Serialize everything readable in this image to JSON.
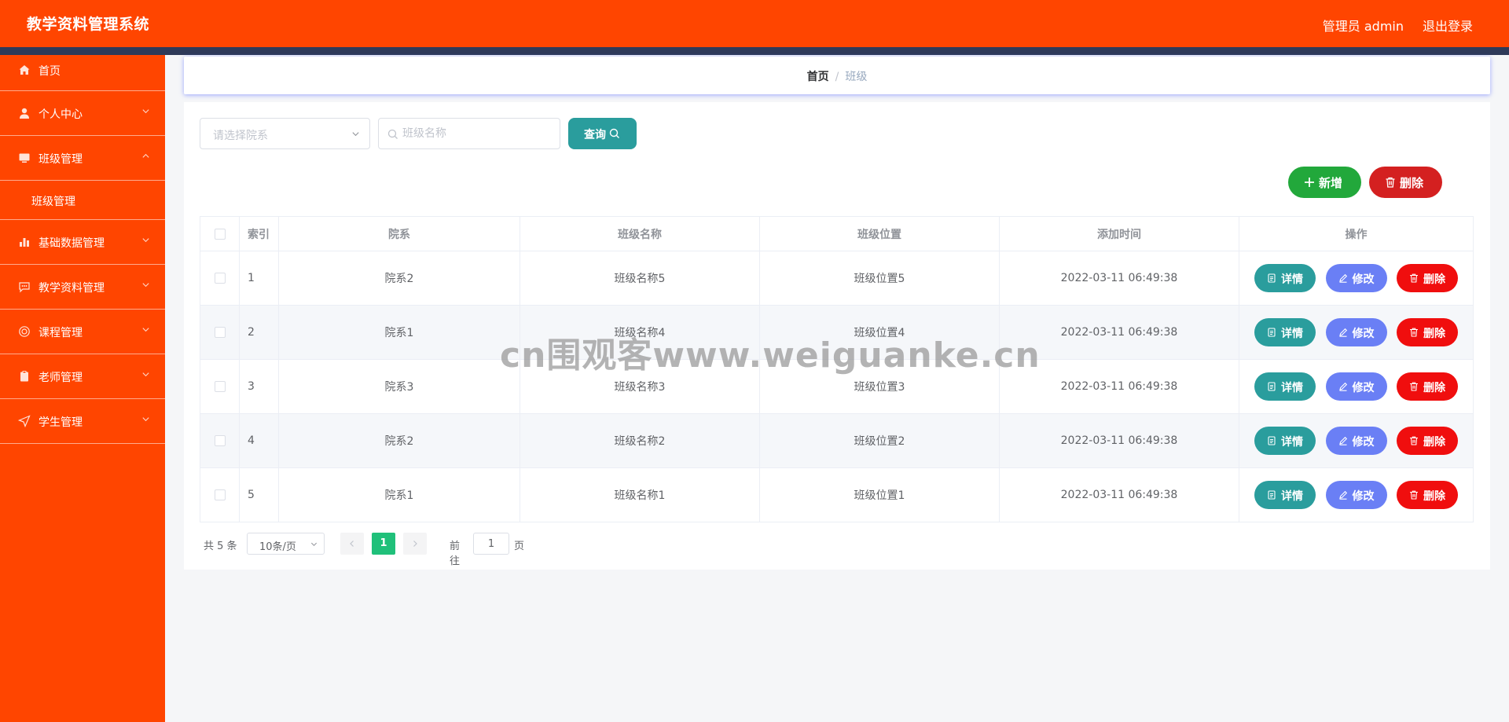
{
  "header": {
    "app_title": "教学资料管理系统",
    "user_label": "管理员 admin",
    "logout_label": "退出登录"
  },
  "sidebar": {
    "items": [
      {
        "label": "首页",
        "icon": "home-icon"
      },
      {
        "label": "个人中心",
        "icon": "user-icon"
      },
      {
        "label": "班级管理",
        "icon": "monitor-icon",
        "expanded": true,
        "children": [
          {
            "label": "班级管理"
          }
        ]
      },
      {
        "label": "基础数据管理",
        "icon": "bar-chart-icon"
      },
      {
        "label": "教学资料管理",
        "icon": "chat-icon"
      },
      {
        "label": "课程管理",
        "icon": "help-circle-icon"
      },
      {
        "label": "老师管理",
        "icon": "clipboard-icon"
      },
      {
        "label": "学生管理",
        "icon": "send-icon"
      }
    ]
  },
  "breadcrumb": {
    "home": "首页",
    "separator": "/",
    "current": "班级"
  },
  "filters": {
    "department_placeholder": "请选择院系",
    "class_name_placeholder": "班级名称",
    "query_label": "查询"
  },
  "toolbar": {
    "add_label": "新增",
    "delete_label": "删除"
  },
  "table": {
    "columns": [
      "索引",
      "院系",
      "班级名称",
      "班级位置",
      "添加时间",
      "操作"
    ],
    "rows": [
      {
        "index": "1",
        "department": "院系2",
        "class_name": "班级名称5",
        "location": "班级位置5",
        "added_time": "2022-03-11 06:49:38"
      },
      {
        "index": "2",
        "department": "院系1",
        "class_name": "班级名称4",
        "location": "班级位置4",
        "added_time": "2022-03-11 06:49:38"
      },
      {
        "index": "3",
        "department": "院系3",
        "class_name": "班级名称3",
        "location": "班级位置3",
        "added_time": "2022-03-11 06:49:38"
      },
      {
        "index": "4",
        "department": "院系2",
        "class_name": "班级名称2",
        "location": "班级位置2",
        "added_time": "2022-03-11 06:49:38"
      },
      {
        "index": "5",
        "department": "院系1",
        "class_name": "班级名称1",
        "location": "班级位置1",
        "added_time": "2022-03-11 06:49:38"
      }
    ],
    "actions": {
      "detail": "详情",
      "edit": "修改",
      "delete": "删除"
    }
  },
  "pagination": {
    "total_label": "共 5 条",
    "page_size": "10条/页",
    "current_page": "1",
    "goto_label": "前往",
    "goto_value": "1",
    "goto_suffix": "页"
  },
  "watermark": "cn围观客www.weiguanke.cn",
  "colors": {
    "header_bg": "#ff4500",
    "sidebar_bg": "#ff4500",
    "stripe": "#2e3a59",
    "query": "#2a9d9d",
    "add": "#22a83b",
    "delete_top": "#d42020",
    "detail": "#2a9d9d",
    "edit": "#6a7ff5",
    "delete_row": "#f00e0e",
    "page_active": "#20c07a"
  }
}
